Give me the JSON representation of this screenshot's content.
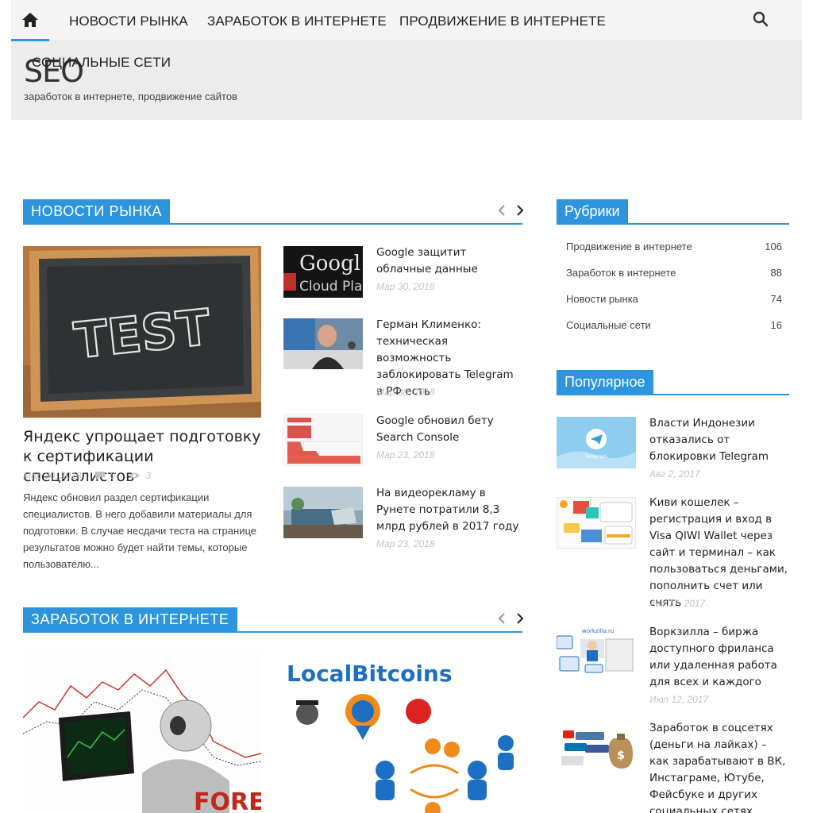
{
  "nav": {
    "items": [
      "НОВОСТИ РЫНКА",
      "ЗАРАБОТОК В ИНТЕРНЕТЕ",
      "ПРОДВИЖЕНИЕ В ИНТЕРНЕТЕ",
      "СОЦИАЛЬНЫЕ СЕТИ"
    ]
  },
  "site": {
    "title": "SEO",
    "description": "заработок в интернете, продвижение сайтов"
  },
  "news_section": {
    "label": "НОВОСТИ РЫНКА",
    "featured": {
      "title": "Яндекс упрощает подготовку к сертификации специалистов",
      "date": "Мар 30, 2018",
      "comments": "0",
      "views": "3",
      "excerpt": "Яндекс обновил раздел сертификации специалистов. В него добавили материалы для подготовки. В случае несдачи теста на странице результатов можно будет найти темы, которые пользователю...",
      "image_text": "TEST"
    },
    "posts": [
      {
        "title": "Google защитит облачные данные",
        "date": "Мар 30, 2018",
        "image_text_1": "Googl",
        "image_text_2": "Cloud Pla"
      },
      {
        "title": "Герман Клименко: техническая возможность заблокировать Telegram в РФ есть",
        "date": "Мар 30, 2018"
      },
      {
        "title": "Google обновил бету Search Console",
        "date": "Мар 23, 2018"
      },
      {
        "title": "На видеорекламу в Рунете потратили 8,3 млрд рублей в 2017 году",
        "date": "Мар 23, 2018"
      }
    ]
  },
  "earn_section": {
    "label": "ЗАРАБОТОК В ИНТЕРНЕТЕ",
    "image1_text": "FOREX",
    "image2_text": "LocalBitcoins"
  },
  "categories": {
    "label": "Рубрики",
    "items": [
      {
        "name": "Продвижение в интернете",
        "count": "106"
      },
      {
        "name": "Заработок в интернете",
        "count": "88"
      },
      {
        "name": "Новости рынка",
        "count": "74"
      },
      {
        "name": "Социальные сети",
        "count": "16"
      }
    ]
  },
  "popular": {
    "label": "Популярное",
    "posts": [
      {
        "title": "Власти Индонезии отказались от блокировки Telegram",
        "date": "Авг 2, 2017",
        "image_text": "Telegram"
      },
      {
        "title": "Киви кошелек – регистрация и вход в Visa QIWI Wallet через сайт и терминал – как пользоваться деньгами, пополнить счет или снять",
        "date": "Авг 17, 2017"
      },
      {
        "title": "Воркзилла – биржа доступного фриланса или удаленная работа для всех и каждого",
        "date": "Июл 12, 2017",
        "image_text": "workzilla.ru"
      },
      {
        "title": "Заработок в соцсетях (деньги на лайках) – как зарабатывают в ВК, Инстаграме, Ютубе, Фейсбуке и других социальных сетях",
        "date": ""
      }
    ]
  },
  "colors": {
    "accent": "#2c95de",
    "nav_bg": "#f4f4f4",
    "header_bg": "#ececec"
  }
}
